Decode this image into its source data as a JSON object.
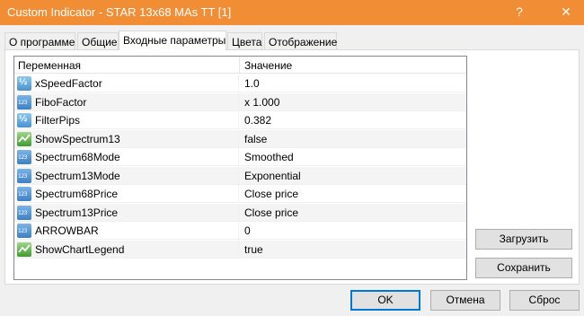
{
  "window": {
    "title": "Custom Indicator - STAR 13x68 MAs TT [1]",
    "help_glyph": "?",
    "close_glyph": "✕"
  },
  "tabs": [
    {
      "label": "О программе"
    },
    {
      "label": "Общие"
    },
    {
      "label": "Входные параметры"
    },
    {
      "label": "Цвета"
    },
    {
      "label": "Отображение"
    }
  ],
  "grid": {
    "col_name": "Переменная",
    "col_value": "Значение",
    "rows": [
      {
        "icon": "double-type-icon",
        "icon_text": "½",
        "name": "xSpeedFactor",
        "value": "1.0"
      },
      {
        "icon": "integer-type-icon",
        "icon_text": "123",
        "name": "FiboFactor",
        "value": "x 1.000"
      },
      {
        "icon": "double-type-icon",
        "icon_text": "½",
        "name": "FilterPips",
        "value": "0.382"
      },
      {
        "icon": "boolean-type-icon",
        "icon_text": "",
        "name": "ShowSpectrum13",
        "value": "false"
      },
      {
        "icon": "integer-type-icon",
        "icon_text": "123",
        "name": "Spectrum68Mode",
        "value": "Smoothed"
      },
      {
        "icon": "integer-type-icon",
        "icon_text": "123",
        "name": "Spectrum13Mode",
        "value": "Exponential"
      },
      {
        "icon": "integer-type-icon",
        "icon_text": "123",
        "name": "Spectrum68Price",
        "value": "Close price"
      },
      {
        "icon": "integer-type-icon",
        "icon_text": "123",
        "name": "Spectrum13Price",
        "value": "Close price"
      },
      {
        "icon": "integer-type-icon",
        "icon_text": "123",
        "name": "ARROWBAR",
        "value": "0"
      },
      {
        "icon": "boolean-type-icon",
        "icon_text": "",
        "name": "ShowChartLegend",
        "value": "true"
      }
    ]
  },
  "side_buttons": {
    "load_label": "Загрузить",
    "save_label": "Сохранить"
  },
  "footer": {
    "ok_label": "OK",
    "cancel_label": "Отмена",
    "reset_label": "Сброс"
  },
  "colors": {
    "titlebar": "#f08d35",
    "accent": "#0078d7"
  }
}
